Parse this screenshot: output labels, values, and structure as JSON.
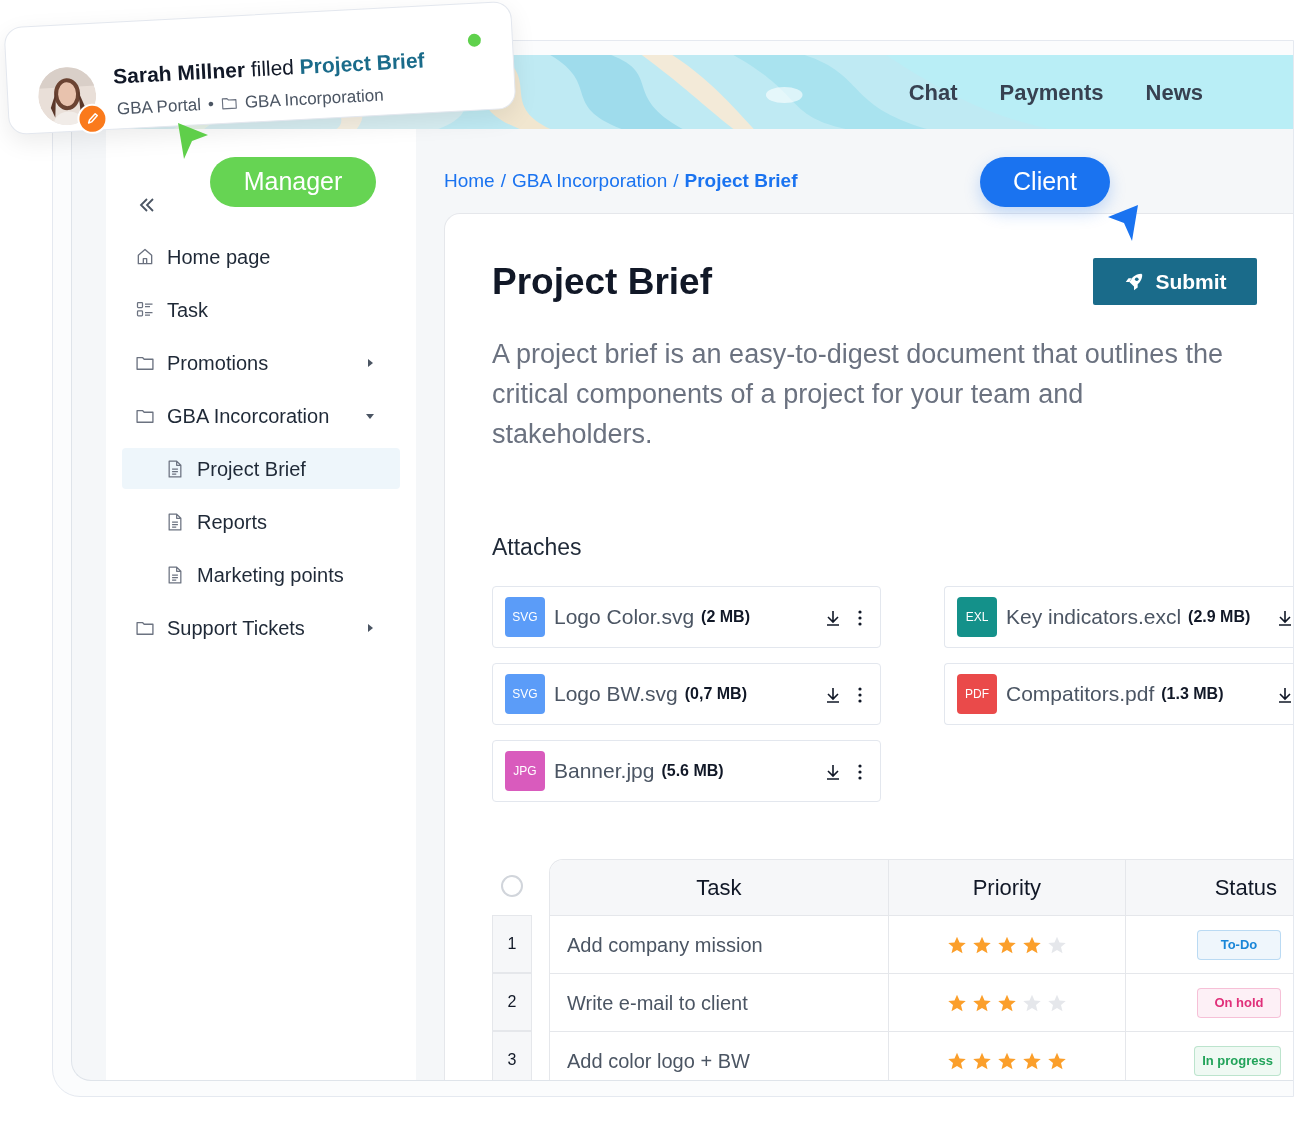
{
  "notification": {
    "author": "Sarah Millner",
    "action": "filled",
    "document": "Project Brief",
    "source": "GBA Portal",
    "separator": "•",
    "folder": "GBA Incorporation",
    "online": true
  },
  "top_nav": [
    {
      "label": "Chat"
    },
    {
      "label": "Payments"
    },
    {
      "label": "News"
    }
  ],
  "sidebar": {
    "role_tag": "Manager",
    "items": [
      {
        "label": "Home page",
        "kind": "home"
      },
      {
        "label": "Task",
        "kind": "task"
      },
      {
        "label": "Promotions",
        "kind": "folder",
        "expanded": false
      },
      {
        "label": "GBA Incorcoration",
        "kind": "folder",
        "expanded": true,
        "children": [
          {
            "label": "Project Brief",
            "kind": "document",
            "selected": true
          },
          {
            "label": "Reports",
            "kind": "document",
            "selected": false
          },
          {
            "label": "Marketing points",
            "kind": "document",
            "selected": false
          }
        ]
      },
      {
        "label": "Support Tickets",
        "kind": "folder",
        "expanded": false
      }
    ]
  },
  "breadcrumb": [
    {
      "label": "Home",
      "current": false,
      "separator": "/"
    },
    {
      "label": "GBA Incorporation",
      "current": false,
      "separator": "/"
    },
    {
      "label": "Project Brief",
      "current": true
    }
  ],
  "role_tag": "Client",
  "brief": {
    "title": "Project Brief",
    "submit": "Submit",
    "description": "A project brief is an easy-to-digest document that outlines the critical components of a project for your team and stakeholders."
  },
  "attaches": {
    "heading": "Attaches",
    "files": [
      {
        "badge": "SVG",
        "color": "#5b9cf8",
        "name": "Logo Color.svg",
        "size": "(2 MB)"
      },
      {
        "badge": "EXL",
        "color": "#14918a",
        "name": "Key indicators.excl",
        "size": "(2.9 MB)"
      },
      {
        "badge": "SVG",
        "color": "#5b9cf8",
        "name": "Logo BW.svg",
        "size": "(0,7 MB)"
      },
      {
        "badge": "PDF",
        "color": "#ea4a4a",
        "name": "Compatitors.pdf",
        "size": "(1.3 MB)"
      },
      {
        "badge": "JPG",
        "color": "#d95bbd",
        "name": "Banner.jpg",
        "size": "(5.6 MB)"
      }
    ]
  },
  "tasks": {
    "select_all": {
      "checked": false
    },
    "columns": [
      "Task",
      "Priority",
      "Status"
    ],
    "rows": [
      {
        "number": "1",
        "task": "Add company mission",
        "stars": 4,
        "status": "To-Do",
        "color": "#1a86d8"
      },
      {
        "number": "2",
        "task": "Write e-mail to client",
        "stars": 3,
        "status": "On hold",
        "color": "#e0307a"
      },
      {
        "number": "3",
        "task": "Add color logo + BW",
        "stars": 5,
        "status": "In progress",
        "color": "#22a35a"
      }
    ]
  }
}
